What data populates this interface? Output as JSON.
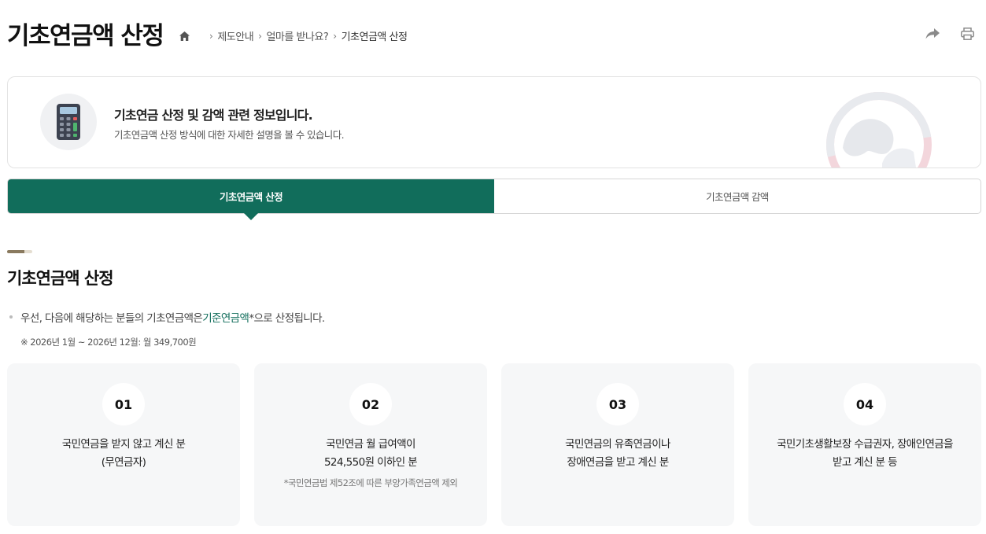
{
  "page": {
    "title": "기초연금액 산정"
  },
  "breadcrumb": {
    "items": [
      "제도안내",
      "얼마를 받나요?",
      "기초연금액 산정"
    ]
  },
  "intro": {
    "title": "기초연금 산정 및 감액 관련 정보입니다.",
    "subtitle": "기초연금액 산정 방식에 대한 자세한 설명을 볼 수 있습니다."
  },
  "tabs": [
    {
      "label": "기초연금액 산정",
      "active": true
    },
    {
      "label": "기초연금액 감액",
      "active": false
    }
  ],
  "section": {
    "title": "기초연금액 산정",
    "bullet_prefix": "우선, 다음에 해당하는 분들의 기초연금액은 ",
    "bullet_highlight": "기준연금액",
    "bullet_suffix": "*으로 산정됩니다.",
    "note": "※ 2026년 1월 ~ 2026년 12월: 월 349,700원"
  },
  "cards": [
    {
      "number": "01",
      "line1": "국민연금을 받지 않고 계신 분",
      "line2": "(무연금자)",
      "sub": ""
    },
    {
      "number": "02",
      "line1": "국민연금 월 급여액이",
      "line2": "524,550원 이하인 분",
      "sub": "*국민연금법 제52조에 따른 부양가족연금액 제외"
    },
    {
      "number": "03",
      "line1": "국민연금의 유족연금이나",
      "line2": "장애연금을 받고 계신 분",
      "sub": ""
    },
    {
      "number": "04",
      "line1": "국민기초생활보장 수급권자, 장애인연금을",
      "line2": "받고 계신 분 등",
      "sub": ""
    }
  ],
  "colors": {
    "primary": "#116d5b",
    "accent_bar": "#8a7a5f",
    "card_bg": "#f6f7f8"
  },
  "icons": [
    "home-icon",
    "share-icon",
    "print-icon",
    "calculator-icon"
  ]
}
